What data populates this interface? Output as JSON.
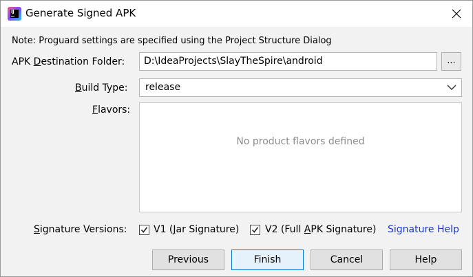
{
  "window": {
    "title": "Generate Signed APK",
    "icon": "intellij-idea-icon",
    "close_icon": "close-icon"
  },
  "note": "Note: Proguard settings are specified using the Project Structure Dialog",
  "form": {
    "destination": {
      "label": "APK Destination Folder:",
      "value": "D:\\IdeaProjects\\SlayTheSpire\\android",
      "browse_label": "..."
    },
    "build_type": {
      "label": "Build Type:",
      "value": "release"
    },
    "flavors": {
      "label": "Flavors:",
      "empty_text": "No product flavors defined"
    },
    "signature": {
      "label": "Signature Versions:",
      "v1": {
        "label": "V1 (Jar Signature)",
        "checked": true
      },
      "v2": {
        "label": "V2 (Full APK Signature)",
        "checked": true
      },
      "help_link": "Signature Help"
    }
  },
  "buttons": {
    "previous": "Previous",
    "finish": "Finish",
    "cancel": "Cancel",
    "help": "Help"
  },
  "colors": {
    "link": "#1a37c8",
    "default_button_border": "#0078d7"
  }
}
